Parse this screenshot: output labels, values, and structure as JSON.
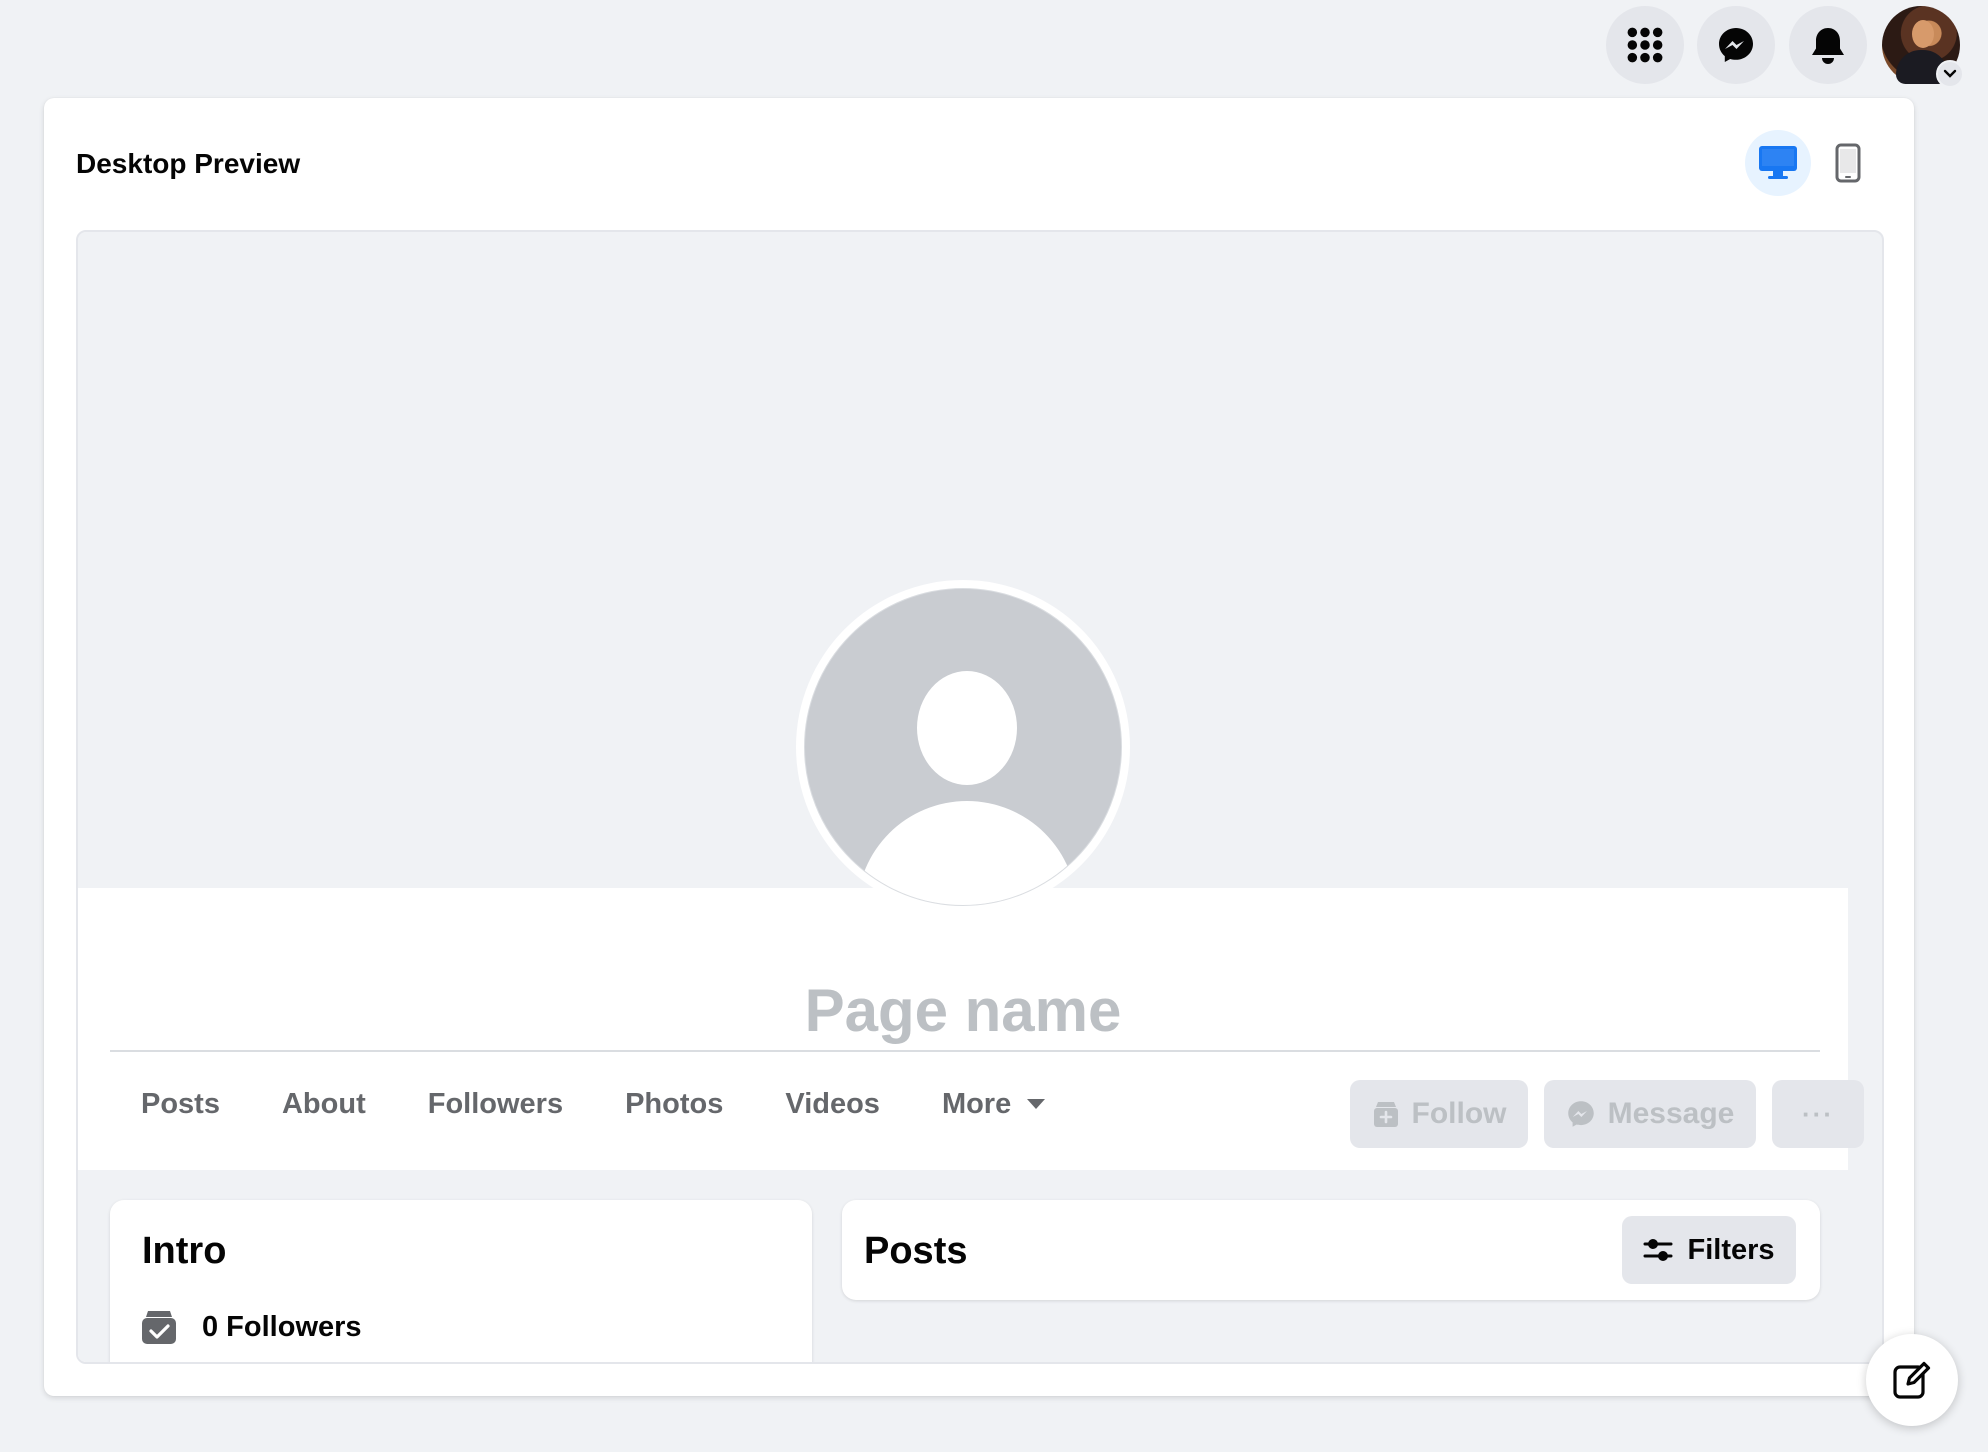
{
  "topbar": {
    "menu_icon": "grid-menu-icon",
    "messenger_icon": "messenger-icon",
    "notifications_icon": "bell-icon",
    "account_icon": "account-chevron-icon"
  },
  "panel": {
    "title": "Desktop Preview",
    "desktop_icon": "desktop-monitor-icon",
    "mobile_icon": "mobile-phone-icon"
  },
  "profile": {
    "page_name": "Page name"
  },
  "tabs": [
    {
      "label": "Posts"
    },
    {
      "label": "About"
    },
    {
      "label": "Followers"
    },
    {
      "label": "Photos"
    },
    {
      "label": "Videos"
    },
    {
      "label": "More"
    }
  ],
  "actions": {
    "follow": "Follow",
    "message": "Message",
    "more": "···"
  },
  "intro": {
    "title": "Intro",
    "followers": "0 Followers"
  },
  "posts": {
    "title": "Posts",
    "filters": "Filters"
  },
  "colors": {
    "accent": "#1877f2",
    "background": "#f0f2f5",
    "muted_text": "#65676b",
    "disabled_text": "#bcc0c4"
  }
}
